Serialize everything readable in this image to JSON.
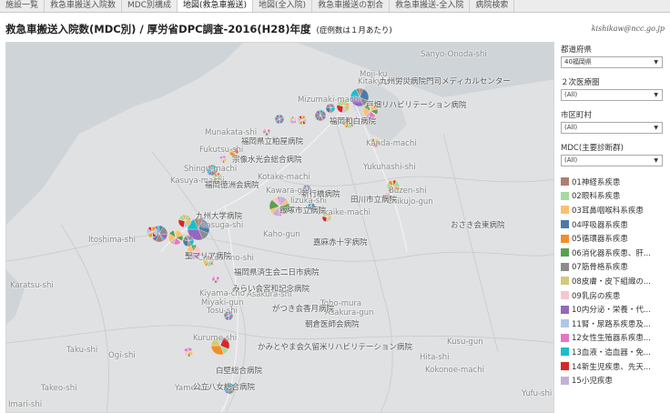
{
  "tabs": [
    {
      "label": "施設一覧",
      "active": false
    },
    {
      "label": "救急車搬送入院数",
      "active": false
    },
    {
      "label": "MDC別構成",
      "active": false
    },
    {
      "label": "地図(救急車搬送)",
      "active": true
    },
    {
      "label": "地図(全入院)",
      "active": false
    },
    {
      "label": "救急車搬送の割合",
      "active": false
    },
    {
      "label": "救急車搬送-全入院",
      "active": false
    },
    {
      "label": "病院検索",
      "active": false
    }
  ],
  "header": {
    "title": "救急車搬送入院数(MDC別) / 厚労省DPC調査-2016(H28)年度",
    "note": "(症例数は１月あたり)",
    "author": "kishikaw@ncc.go.jp"
  },
  "filters": {
    "prefecture_label": "都道府県",
    "prefecture_value": "40福岡県",
    "region_label": "２次医療圏",
    "region_value": "(All)",
    "city_label": "市区町村",
    "city_value": "(All)",
    "mdc_label": "MDC(主要診断群)",
    "mdc_value": "(All)"
  },
  "legend": [
    {
      "label": "01神経系疾患",
      "color": "#b07d73"
    },
    {
      "label": "02眼科系疾患",
      "color": "#a6dba0"
    },
    {
      "label": "03耳鼻咽喉科系疾患",
      "color": "#fdbf6f"
    },
    {
      "label": "04呼吸器系疾患",
      "color": "#4e79a7"
    },
    {
      "label": "05循環器系疾患",
      "color": "#f28e2b"
    },
    {
      "label": "06消化器系疾患、肝...",
      "color": "#59a14f"
    },
    {
      "label": "07筋骨格系疾患",
      "color": "#8c8c8c"
    },
    {
      "label": "08皮膚・皮下組織の...",
      "color": "#d4c97a"
    },
    {
      "label": "09乳房の疾患",
      "color": "#f7c6d0"
    },
    {
      "label": "10内分泌・栄養・代...",
      "color": "#9467bd"
    },
    {
      "label": "11腎・尿路系疾患及...",
      "color": "#aec7e8"
    },
    {
      "label": "12女性生殖器系疾患...",
      "color": "#e377c2"
    },
    {
      "label": "13血液・造血器・免...",
      "color": "#17becf"
    },
    {
      "label": "14新生児疾患、先天...",
      "color": "#d62728"
    },
    {
      "label": "15小児疾患",
      "color": "#c5b0d5"
    }
  ],
  "map": {
    "place_labels": [
      "Sanyo-Onoda-shi",
      "Moji-ku",
      "Kitakyushu-shi",
      "Mizumaki-machi",
      "Munakata-shi",
      "Fukutsu-shi",
      "Kanda-machi",
      "Yukuhashi-shi",
      "Shingu-machi",
      "Kasuya-machi",
      "Kotake-machi",
      "Kawara-gun",
      "Iizuka-shi",
      "Akaike-machi",
      "Buzen-shi",
      "Chikujo-gun",
      "Kasuga-shi",
      "Kaho-gun",
      "Itoshima-shi",
      "Chikushino-shi",
      "Karatsu-shi",
      "Kiyama-cho",
      "Miyaki-gun",
      "Asakura-shi",
      "Tosu-shi",
      "Toho-mura",
      "Asakura-gun",
      "Taku-shi",
      "Ogi-shi",
      "Kurume-shi",
      "Hita-shi",
      "Kusu-gun",
      "Kokonoe-machi",
      "Takeo-shi",
      "Yame-shi",
      "Yufu-shi",
      "Imari-shi"
    ],
    "hospital_labels": [
      "九州労災病院門司メディカルセンター",
      "戸畑リハビリテーション病院",
      "宗像水光会総合病院",
      "福岡和白病院",
      "福岡県済生会二日市病院",
      "がつき会香月病院",
      "かみとやま会久留米リハビリテーション病院",
      "白壁総合病院",
      "公立八女総合病院",
      "飯塚市立病院",
      "田川市立病院",
      "嘉麻赤十字病院",
      "新行橋病院",
      "みらい会宮和記念病院",
      "福岡徳洲会病院",
      "九州大学病院",
      "おさき会東病院",
      "福岡県立粕屋病院",
      "朝倉医師会病院",
      "聖マリア病院"
    ]
  }
}
